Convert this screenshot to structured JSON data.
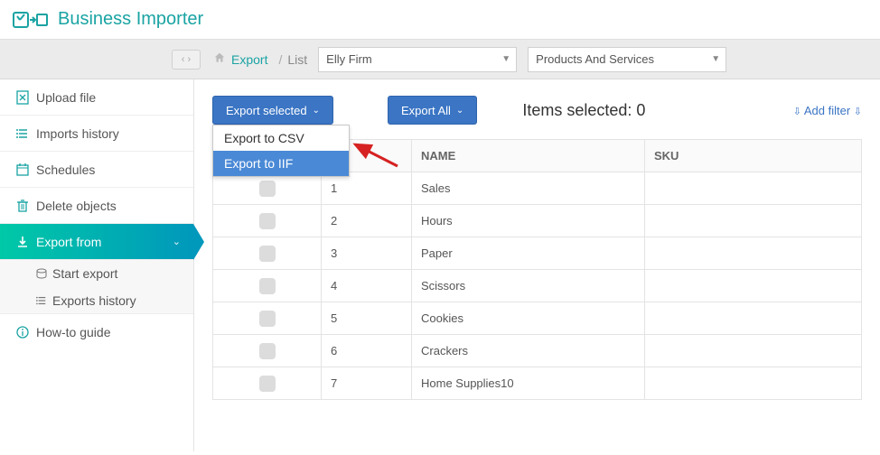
{
  "brand": {
    "title": "Business Importer"
  },
  "breadcrumb": {
    "export": "Export",
    "list": "List"
  },
  "topbar": {
    "company_select": "Elly Firm",
    "type_select": "Products And Services"
  },
  "sidebar": {
    "upload": "Upload file",
    "imports_history": "Imports history",
    "schedules": "Schedules",
    "delete_objects": "Delete objects",
    "export_from": "Export from",
    "start_export": "Start export",
    "exports_history": "Exports history",
    "howto": "How-to guide"
  },
  "toolbar": {
    "export_selected": "Export selected",
    "export_all": "Export All",
    "items_selected_label": "Items selected:",
    "items_selected_count": "0",
    "add_filter": "Add filter"
  },
  "dropdown": {
    "csv": "Export to CSV",
    "iif": "Export to IIF"
  },
  "table": {
    "header_name": "NAME",
    "header_sku": "SKU",
    "rows": [
      {
        "n": "1",
        "name": "Sales",
        "sku": ""
      },
      {
        "n": "2",
        "name": "Hours",
        "sku": ""
      },
      {
        "n": "3",
        "name": "Paper",
        "sku": ""
      },
      {
        "n": "4",
        "name": "Scissors",
        "sku": ""
      },
      {
        "n": "5",
        "name": "Cookies",
        "sku": ""
      },
      {
        "n": "6",
        "name": "Crackers",
        "sku": ""
      },
      {
        "n": "7",
        "name": "Home Supplies10",
        "sku": ""
      }
    ]
  }
}
